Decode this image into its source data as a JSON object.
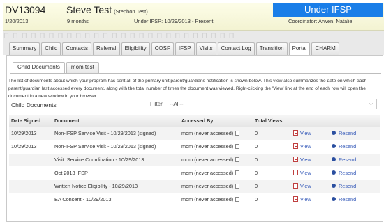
{
  "header": {
    "case_id": "DV13094",
    "child_name": "Steve Test",
    "child_alias": "(Stephon Test)",
    "dob": "1/20/2013",
    "age": "9 months",
    "program": "Under IFSP: 10/29/2013 - Present",
    "status": "Under IFSP",
    "coordinator": "Coordinator: Arwen, Natalie",
    "status_color": "#1a7ee8"
  },
  "tabs": [
    "Summary",
    "Child",
    "Contacts",
    "Referral",
    "Eligibility",
    "COSF",
    "IFSP",
    "Visits",
    "Contact Log",
    "Transition",
    "Portal",
    "CHARM"
  ],
  "active_tab": "Portal",
  "subtabs": [
    "Child Documents",
    "mom test"
  ],
  "active_subtab": "Child Documents",
  "description": "The list of documents about which your program has sent all of the primary unit parent/guardians notification is shown below. This view also summarizes the date on which each parent/guardian last accessed every document, along with the total number of times the document was viewed. Right-clicking the 'View' link at the end of each row will open the document in a new window in your browser.",
  "section_title": "Child Documents",
  "filter": {
    "label": "Filter",
    "value": "--All--"
  },
  "table": {
    "columns": [
      "Date Signed",
      "Document",
      "Accessed By",
      "Total Views"
    ],
    "view_label": "View",
    "resend_label": "Resend",
    "rows": [
      {
        "date": "10/29/2013",
        "document": "Non-IFSP Service Visit - 10/29/2013 (signed)",
        "accessed_by": "mom (never accessed)",
        "views": "0"
      },
      {
        "date": "10/29/2013",
        "document": "Non-IFSP Service Visit - 10/29/2013 (signed)",
        "accessed_by": "mom (never accessed)",
        "views": "0"
      },
      {
        "date": "",
        "document": "Visit: Service Coordination - 10/29/2013",
        "accessed_by": "mom (never accessed)",
        "views": "0"
      },
      {
        "date": "",
        "document": "Oct 2013 IFSP",
        "accessed_by": "mom (never accessed)",
        "views": "0"
      },
      {
        "date": "",
        "document": "Written Notice Eligibility - 10/29/2013",
        "accessed_by": "mom (never accessed)",
        "views": "0"
      },
      {
        "date": "",
        "document": "EA Consent - 10/29/2013",
        "accessed_by": "mom (never accessed)",
        "views": "0"
      }
    ]
  }
}
